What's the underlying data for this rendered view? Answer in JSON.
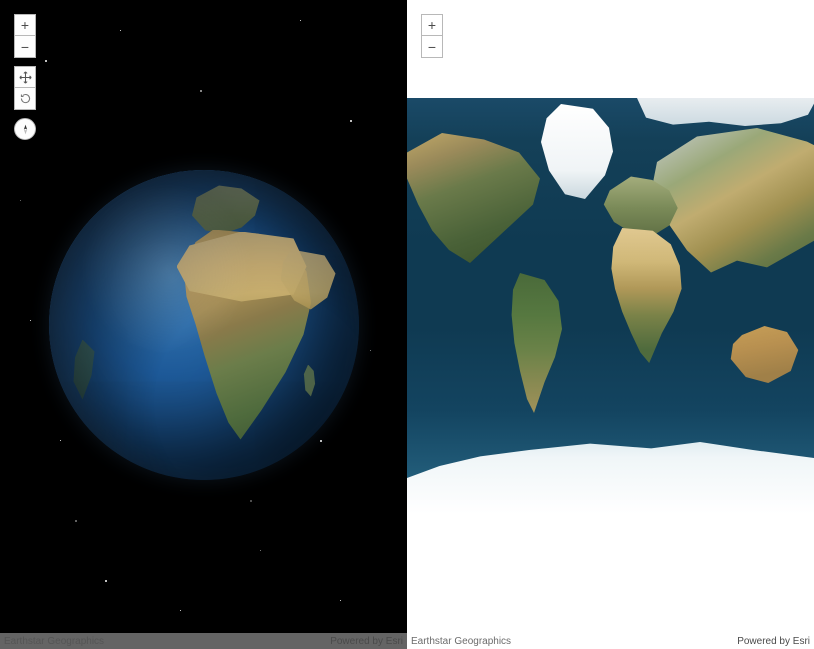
{
  "left": {
    "controls": {
      "zoom_in_label": "+",
      "zoom_out_label": "−",
      "pan_tool": "pan",
      "rotate_tool": "rotate",
      "compass_tool": "compass"
    },
    "attribution_left": "Earthstar Geographics",
    "attribution_right": "Powered by Esri"
  },
  "right": {
    "controls": {
      "zoom_in_label": "+",
      "zoom_out_label": "−"
    },
    "attribution_left": "Earthstar Geographics",
    "attribution_right": "Powered by Esri"
  },
  "chart_data": {
    "type": "map",
    "views": [
      {
        "id": "globe-3d",
        "projection": "orthographic",
        "basemap": "satellite-imagery",
        "center_approx": {
          "lat": 5,
          "lon": 20
        },
        "visible_continents": [
          "Africa",
          "Europe",
          "Middle East",
          "South America (edge)",
          "Madagascar"
        ],
        "background": "starfield"
      },
      {
        "id": "flat-2d",
        "projection": "web-mercator",
        "basemap": "satellite-imagery",
        "extent": "world",
        "visible_continents": [
          "North America",
          "South America",
          "Greenland",
          "Europe",
          "Africa",
          "Asia",
          "Australia",
          "Antarctica"
        ],
        "background": "white"
      }
    ]
  },
  "colors": {
    "ocean_deep": "#0f3a52",
    "ocean_mid": "#1a5e84",
    "desert": "#d8c088",
    "forest": "#4a6238",
    "ice": "#ffffff",
    "space": "#000000"
  }
}
